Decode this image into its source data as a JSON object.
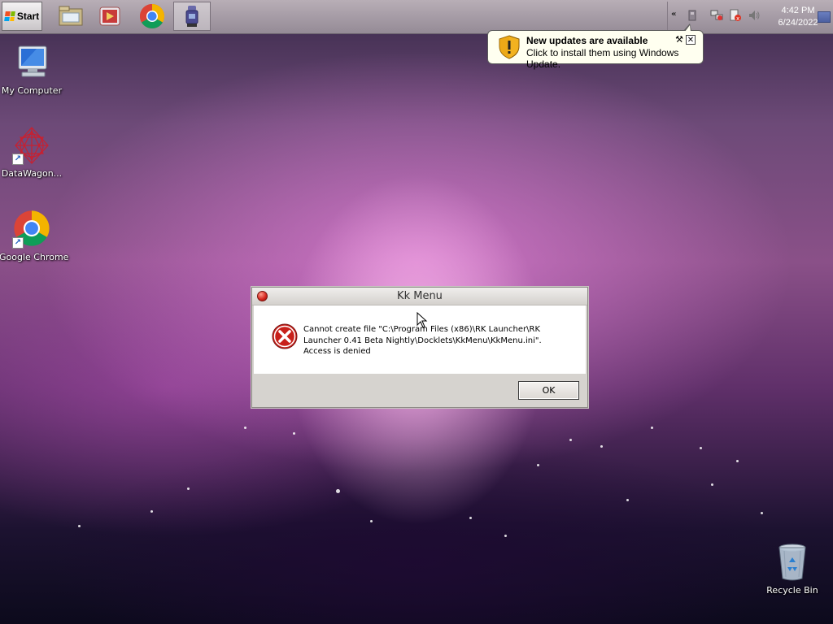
{
  "taskbar": {
    "start_label": "Start",
    "pinned": [
      {
        "icon": "file-explorer-icon"
      },
      {
        "icon": "media-player-icon"
      },
      {
        "icon": "chrome-icon"
      },
      {
        "icon": "kk-launcher-icon",
        "active": true
      }
    ],
    "tray": {
      "icons": [
        "show-hidden-icons-chevron",
        "usb-icon",
        "network-icon",
        "action-center-icon",
        "volume-icon",
        "show-desktop-icon"
      ],
      "time": "4:42 PM",
      "date": "6/24/2022"
    }
  },
  "notification": {
    "icon": "warning-shield-icon",
    "title": "New updates are available",
    "text": "Click to install them using Windows Update."
  },
  "desktop_icons": [
    {
      "label": "My Computer",
      "icon": "computer-icon"
    },
    {
      "label": "DataWagon...",
      "icon": "datawagon-icon",
      "shortcut": true
    },
    {
      "label": "Google Chrome",
      "icon": "chrome-icon",
      "shortcut": true
    },
    {
      "label": "Recycle Bin",
      "icon": "recycle-bin-icon"
    }
  ],
  "dialog": {
    "title": "Kk Menu",
    "icon": "error-icon",
    "message": "Cannot create file \"C:\\Program Files (x86)\\RK Launcher\\RK Launcher 0.41 Beta Nightly\\Docklets\\KkMenu\\KkMenu.ini\". Access is denied",
    "ok_label": "OK"
  },
  "colors": {
    "error_red": "#d3221a",
    "balloon_bg": "#fffff0",
    "taskbar": "#a69ca6"
  }
}
